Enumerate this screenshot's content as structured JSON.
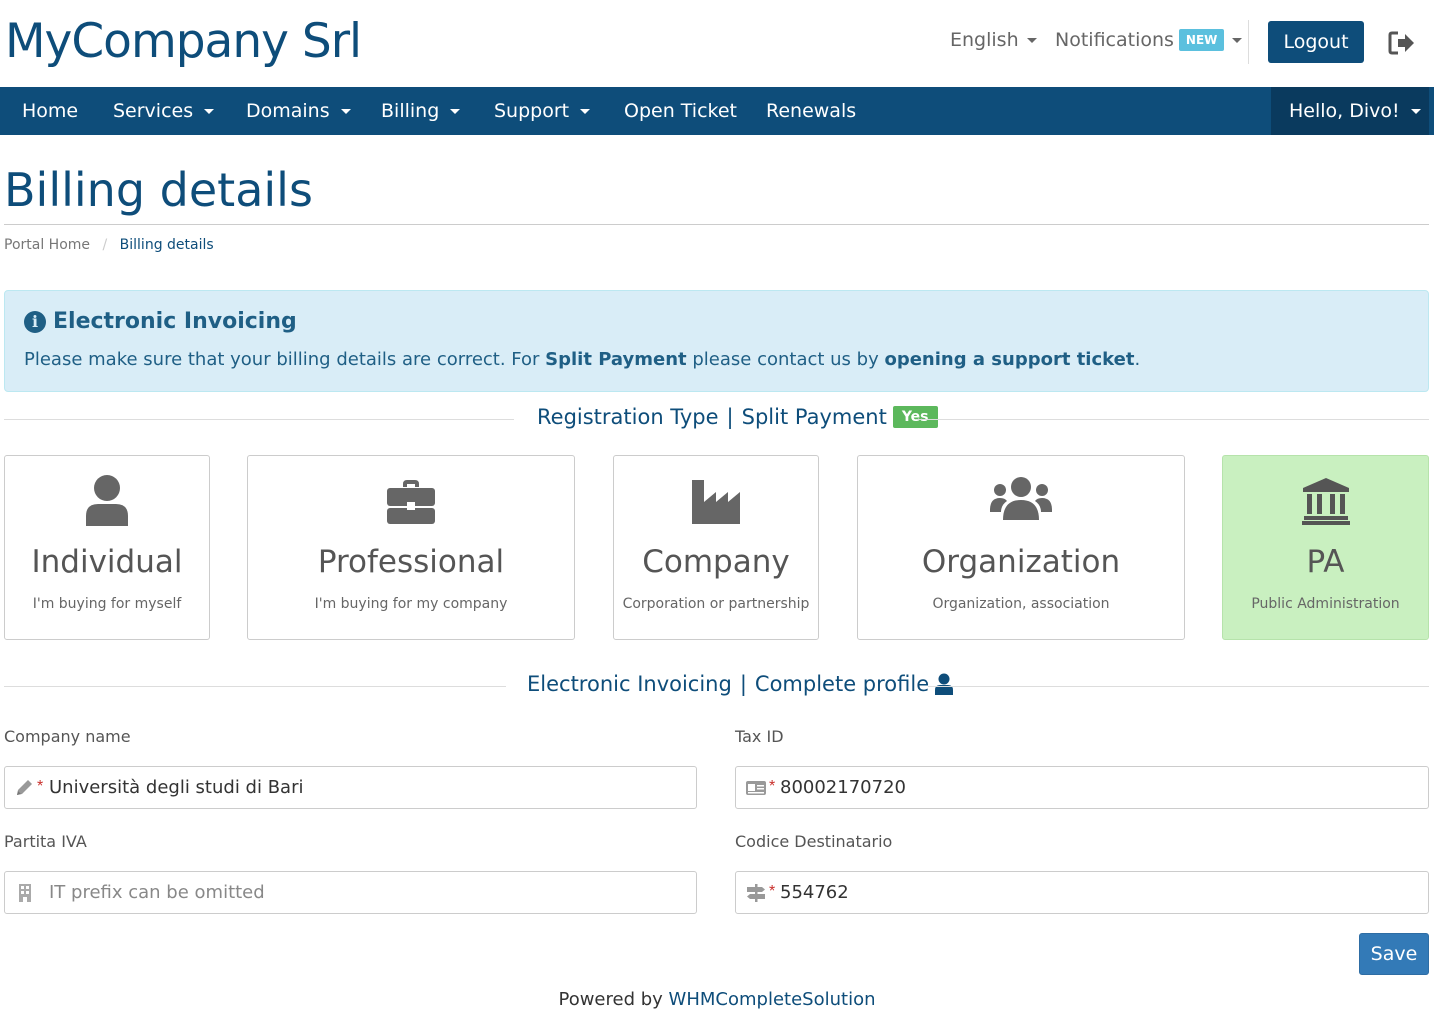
{
  "header": {
    "logo": "MyCompany Srl",
    "language": "English",
    "notifications": "Notifications",
    "notifications_badge": "NEW",
    "logout": "Logout"
  },
  "nav": {
    "items": [
      {
        "label": "Home"
      },
      {
        "label": "Services"
      },
      {
        "label": "Domains"
      },
      {
        "label": "Billing"
      },
      {
        "label": "Support"
      },
      {
        "label": "Open Ticket"
      },
      {
        "label": "Renewals"
      }
    ],
    "user": "Hello, Divo!"
  },
  "page": {
    "title": "Billing details",
    "breadcrumb_home": "Portal Home",
    "breadcrumb_sep": "/",
    "breadcrumb_current": "Billing details"
  },
  "alert": {
    "title": "Electronic Invoicing",
    "text_1": "Please make sure that your billing details are correct. For ",
    "text_bold_1": "Split Payment",
    "text_2": " please contact us by ",
    "text_link": "opening a support ticket",
    "text_3": "."
  },
  "registration": {
    "label_1": "Registration Type",
    "sep": "|",
    "label_2": "Split Payment",
    "badge": "Yes",
    "cards": [
      {
        "title": "Individual",
        "subtitle": "I'm buying for myself",
        "icon": "user-icon",
        "selected": false
      },
      {
        "title": "Professional",
        "subtitle": "I'm buying for my company",
        "icon": "briefcase-icon",
        "selected": false
      },
      {
        "title": "Company",
        "subtitle": "Corporation or partnership",
        "icon": "industry-icon",
        "selected": false
      },
      {
        "title": "Organization",
        "subtitle": "Organization, association",
        "icon": "users-icon",
        "selected": false
      },
      {
        "title": "PA",
        "subtitle": "Public Administration",
        "icon": "university-icon",
        "selected": true
      }
    ]
  },
  "profile": {
    "label_1": "Electronic Invoicing",
    "sep": "|",
    "label_2": "Complete profile"
  },
  "form": {
    "company_name_label": "Company name",
    "company_name_value": "Università degli studi di Bari",
    "tax_id_label": "Tax ID",
    "tax_id_value": "80002170720",
    "partita_iva_label": "Partita IVA",
    "partita_iva_placeholder": "IT prefix can be omitted",
    "codice_label": "Codice Destinatario",
    "codice_value": "554762",
    "required_mark": "*",
    "save": "Save"
  },
  "footer": {
    "text": "Powered by ",
    "link": "WHMCompleteSolution"
  },
  "colors": {
    "brand": "#0e4d7a",
    "alert_bg": "#d9edf7",
    "selected_card": "#c9f0c0",
    "yes_badge": "#5cb85c",
    "new_badge": "#5bc0de",
    "save_button": "#337ab7"
  }
}
